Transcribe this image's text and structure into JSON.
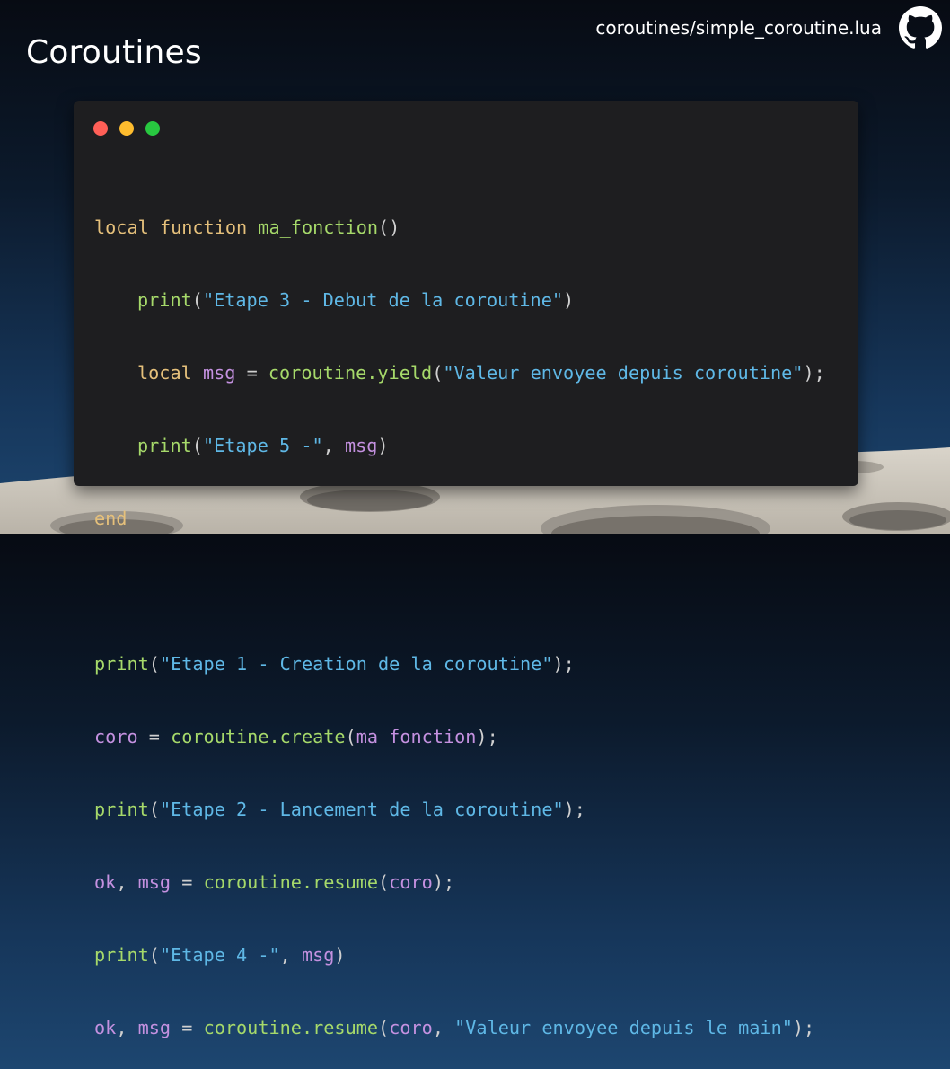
{
  "slide": {
    "title": "Coroutines",
    "file_path": "coroutines/simple_coroutine.lua",
    "link_icon": "github-icon"
  },
  "window": {
    "buttons": [
      "close-dot",
      "minimize-dot",
      "maximize-dot"
    ],
    "colors": {
      "close": "#ff5f57",
      "minimize": "#febc2e",
      "maximize": "#28c840",
      "background": "#1e1e20"
    }
  },
  "code": {
    "language": "lua",
    "tokens": {
      "local": "local",
      "function": "function",
      "end": "end",
      "print": "print",
      "ma_fonction": "ma_fonction",
      "msg": "msg",
      "coro": "coro",
      "ok": "ok",
      "yield": "coroutine.yield",
      "create": "coroutine.create",
      "resume": "coroutine.resume",
      "s_etape3": "\"Etape 3 - Debut de la coroutine\"",
      "s_valeur_coroutine": "\"Valeur envoyee depuis coroutine\"",
      "s_etape5": "\"Etape 5 -\"",
      "s_etape1": "\"Etape 1 - Creation de la coroutine\"",
      "s_etape2": "\"Etape 2 - Lancement de la coroutine\"",
      "s_etape4": "\"Etape 4 -\"",
      "s_valeur_main": "\"Valeur envoyee depuis le main\""
    },
    "colors": {
      "keyword": "#e5c07b",
      "function": "#a6d96a",
      "variable": "#c491e0",
      "string": "#5fb8e6",
      "punctuation": "#d0d0d0"
    }
  }
}
